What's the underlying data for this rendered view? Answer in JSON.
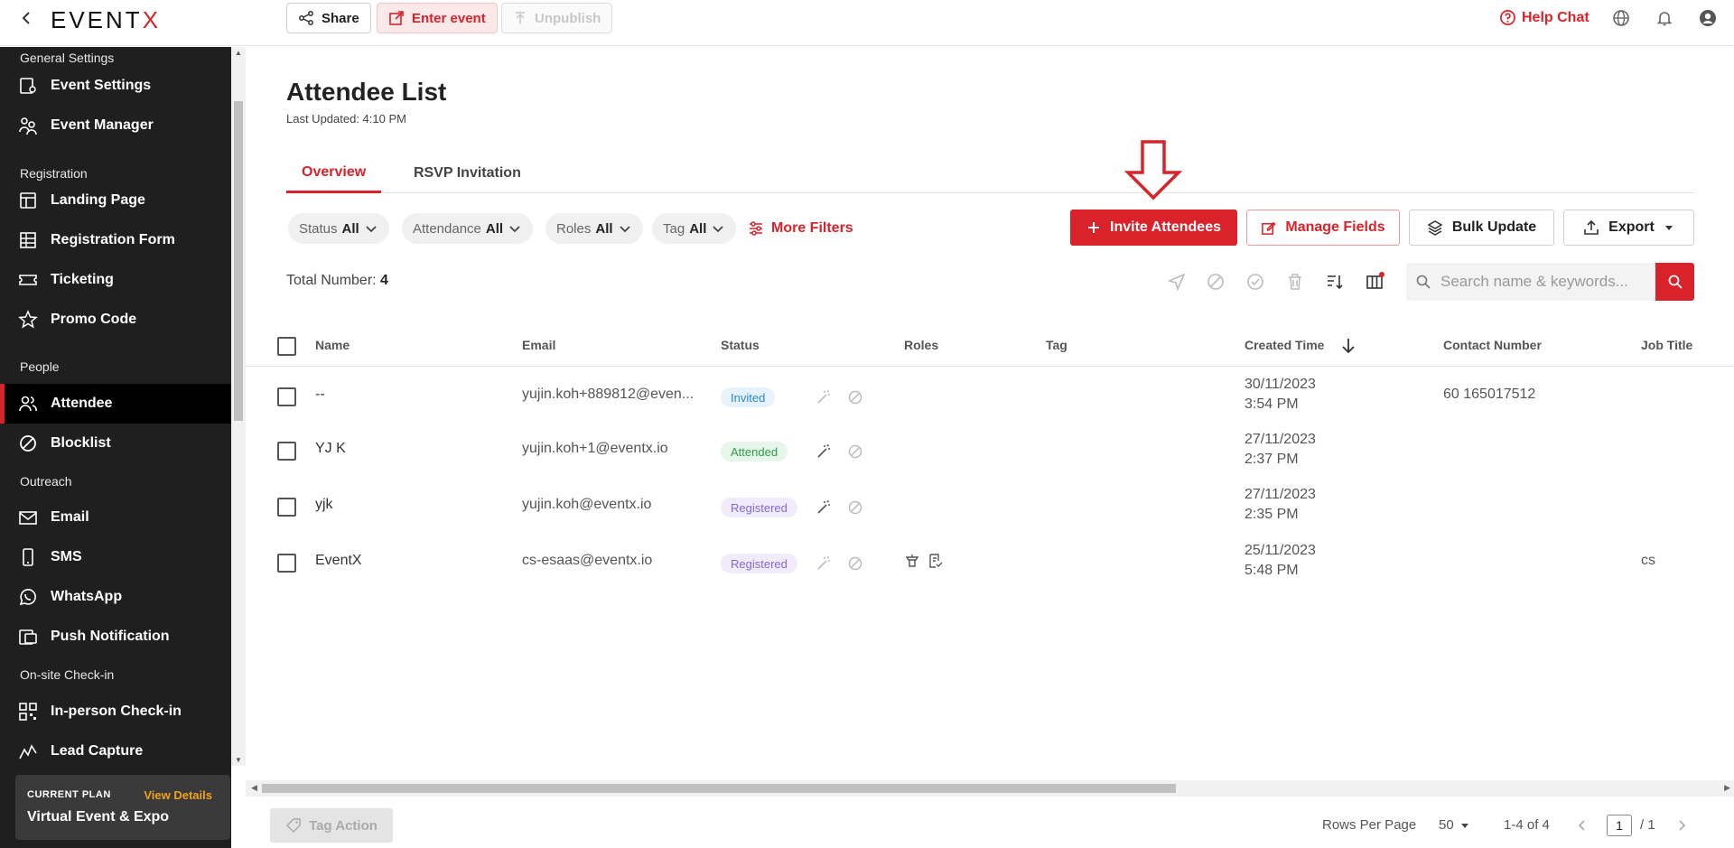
{
  "topbar": {
    "logo_text": "EVENT",
    "logo_x": "X",
    "share_label": "Share",
    "enter_label": "Enter event",
    "unpublish_label": "Unpublish",
    "help_label": "Help Chat"
  },
  "sidebar": {
    "sections": {
      "general": "General Settings",
      "registration": "Registration",
      "people": "People",
      "outreach": "Outreach",
      "checkin": "On-site Check-in"
    },
    "items": {
      "event_settings": "Event Settings",
      "event_manager": "Event Manager",
      "landing_page": "Landing Page",
      "registration_form": "Registration Form",
      "ticketing": "Ticketing",
      "promo_code": "Promo Code",
      "attendee": "Attendee",
      "blocklist": "Blocklist",
      "email": "Email",
      "sms": "SMS",
      "whatsapp": "WhatsApp",
      "push": "Push Notification",
      "inperson": "In-person Check-in",
      "lead": "Lead Capture"
    },
    "plan": {
      "label": "CURRENT PLAN",
      "view": "View Details",
      "name": "Virtual Event & Expo"
    }
  },
  "page": {
    "title": "Attendee List",
    "updated": "Last Updated: 4:10 PM",
    "tabs": {
      "overview": "Overview",
      "rsvp": "RSVP Invitation"
    }
  },
  "filters": {
    "status": {
      "label": "Status",
      "value": "All"
    },
    "attendance": {
      "label": "Attendance",
      "value": "All"
    },
    "roles": {
      "label": "Roles",
      "value": "All"
    },
    "tag": {
      "label": "Tag",
      "value": "All"
    },
    "more": "More Filters"
  },
  "actions": {
    "invite": "Invite Attendees",
    "manage": "Manage Fields",
    "bulk": "Bulk Update",
    "export": "Export"
  },
  "list": {
    "total_label": "Total Number:",
    "total_value": "4",
    "search_placeholder": "Search name & keywords..."
  },
  "table": {
    "headers": {
      "name": "Name",
      "email": "Email",
      "status": "Status",
      "roles": "Roles",
      "tag": "Tag",
      "created": "Created Time",
      "contact": "Contact Number",
      "job": "Job Title"
    },
    "rows": [
      {
        "name": "--",
        "email": "yujin.koh+889812@even...",
        "status": "Invited",
        "date": "30/11/2023",
        "time": "3:54 PM",
        "contact": "60 165017512",
        "job": ""
      },
      {
        "name": "YJ K",
        "email": "yujin.koh+1@eventx.io",
        "status": "Attended",
        "date": "27/11/2023",
        "time": "2:37 PM",
        "contact": "",
        "job": ""
      },
      {
        "name": "yjk",
        "email": "yujin.koh@eventx.io",
        "status": "Registered",
        "date": "27/11/2023",
        "time": "2:35 PM",
        "contact": "",
        "job": ""
      },
      {
        "name": "EventX",
        "email": "cs-esaas@eventx.io",
        "status": "Registered",
        "date": "25/11/2023",
        "time": "5:48 PM",
        "contact": "",
        "job": "cs"
      }
    ]
  },
  "footer": {
    "tag_action": "Tag Action",
    "rows_per_page_label": "Rows Per Page",
    "rows_per_page_value": "50",
    "range": "1-4 of 4",
    "page": "1",
    "page_total": "/ 1"
  },
  "colors": {
    "brand": "#d9222a",
    "sidebar": "#1f1f1f",
    "plan_link": "#f2a11e"
  },
  "icons": {
    "annotation": "down-arrow-outline-icon"
  }
}
